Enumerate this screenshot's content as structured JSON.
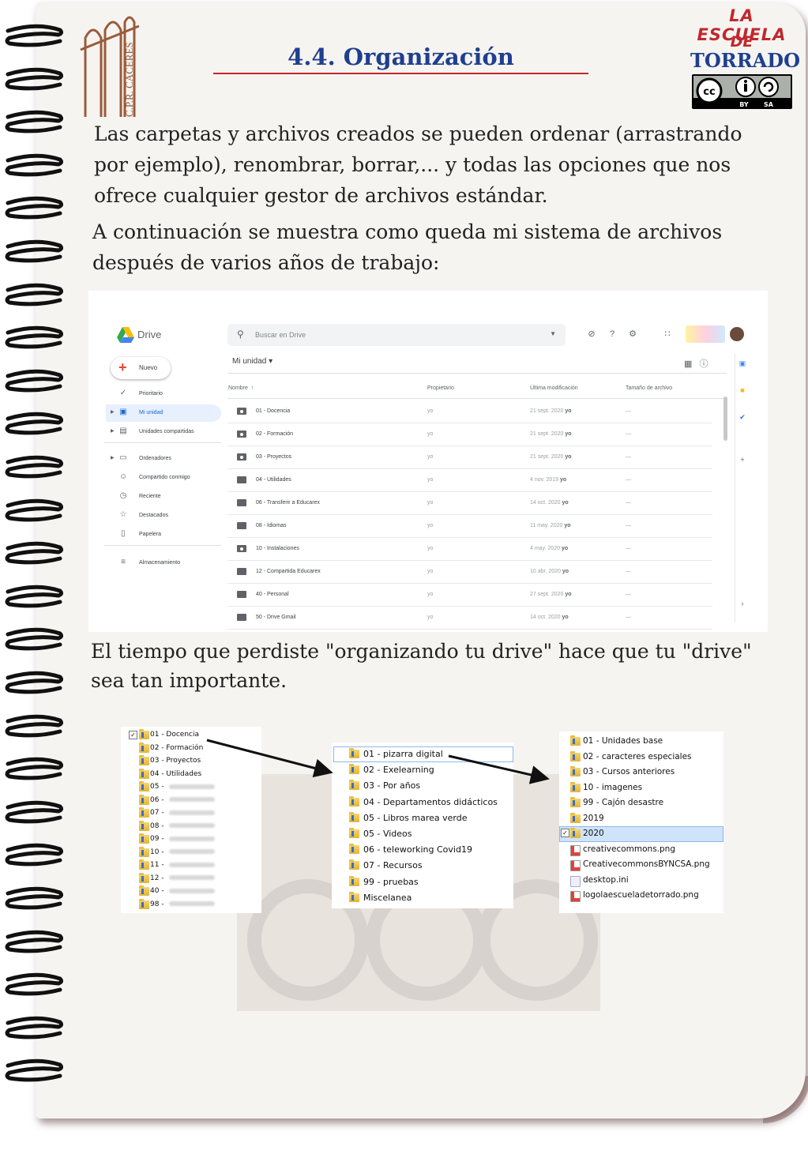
{
  "header": {
    "title": "4.4. Organización",
    "cpr_logo_text": "C.P.R. CÁCERES",
    "brand_line1": "LA ESCUELA",
    "brand_line2": "DE",
    "brand_line3": "TORRADO",
    "license_badge": {
      "cc": "cc",
      "by": "BY",
      "sa": "SA"
    }
  },
  "paragraphs": {
    "p1": "Las carpetas y archivos creados se pueden ordenar (arrastrando por ejemplo), renombrar, borrar,... y todas las opciones que nos ofrece cualquier gestor de archivos estándar.",
    "p2": "A continuación se muestra como queda mi sistema de archivos después de varios años de trabajo:",
    "p3": "El tiempo que perdiste \"organizando tu drive\" hace que tu \"drive\" sea tan importante."
  },
  "drive": {
    "app_name": "Drive",
    "search_placeholder": "Buscar en Drive",
    "new_button": "Nuevo",
    "breadcrumb": "Mi unidad",
    "nav": [
      {
        "label": "Prioritario",
        "icon": "check-circle-icon"
      },
      {
        "label": "Mi unidad",
        "icon": "my-drive-icon",
        "active": true
      },
      {
        "label": "Unidades compartidas",
        "icon": "shared-drives-icon"
      },
      {
        "label": "Ordenadores",
        "icon": "computer-icon"
      },
      {
        "label": "Compartido conmigo",
        "icon": "people-icon"
      },
      {
        "label": "Reciente",
        "icon": "clock-icon"
      },
      {
        "label": "Destacados",
        "icon": "star-icon"
      },
      {
        "label": "Papelera",
        "icon": "trash-icon"
      },
      {
        "label": "Almacenamiento",
        "icon": "storage-icon"
      }
    ],
    "columns": [
      "Nombre",
      "Propietario",
      "Última modificación",
      "Tamaño de archivo"
    ],
    "files": [
      {
        "name": "01 - Docencia",
        "owner": "yo",
        "modified": "21 sept. 2020",
        "by": "yo",
        "size": "—",
        "shared": true
      },
      {
        "name": "02 - Formación",
        "owner": "yo",
        "modified": "21 sept. 2020",
        "by": "yo",
        "size": "—",
        "shared": true
      },
      {
        "name": "03 - Proyectos",
        "owner": "yo",
        "modified": "21 sept. 2020",
        "by": "yo",
        "size": "—",
        "shared": true
      },
      {
        "name": "04 - Utilidades",
        "owner": "yo",
        "modified": "4 nov. 2019",
        "by": "yo",
        "size": "—",
        "shared": false
      },
      {
        "name": "06 - Transferir a Educarex",
        "owner": "yo",
        "modified": "14 oct. 2020",
        "by": "yo",
        "size": "—",
        "shared": false
      },
      {
        "name": "08 - Idiomas",
        "owner": "yo",
        "modified": "11 may. 2020",
        "by": "yo",
        "size": "—",
        "shared": false
      },
      {
        "name": "10 - Instalaciones",
        "owner": "yo",
        "modified": "4 may. 2020",
        "by": "yo",
        "size": "—",
        "shared": true
      },
      {
        "name": "12 - Compartida Educarex",
        "owner": "yo",
        "modified": "10 abr. 2020",
        "by": "yo",
        "size": "—",
        "shared": false
      },
      {
        "name": "40 - Personal",
        "owner": "yo",
        "modified": "27 sept. 2020",
        "by": "yo",
        "size": "—",
        "shared": false
      },
      {
        "name": "50 - Drive Gmail",
        "owner": "yo",
        "modified": "14 oct. 2020",
        "by": "yo",
        "size": "—",
        "shared": false
      }
    ]
  },
  "explorer1": {
    "items": [
      "01 - Docencia",
      "02 - Formación",
      "03 - Proyectos",
      "04 - Utilidades",
      "05 -",
      "06 -",
      "07 -",
      "08 -",
      "09 -",
      "10 -",
      "11 -",
      "12 -",
      "40 -",
      "98 -"
    ],
    "checked_index": 0
  },
  "explorer2": {
    "items": [
      "01 - pizarra digital",
      "02 - Exelearning",
      "03 - Por años",
      "04 - Departamentos didácticos",
      "05 - Libros marea verde",
      "05 - Videos",
      "06 - teleworking Covid19",
      "07 - Recursos",
      "99 - pruebas",
      "Miscelanea"
    ],
    "selected_index": 0
  },
  "explorer3": {
    "items": [
      {
        "name": "01 - Unidades base",
        "kind": "folder"
      },
      {
        "name": "02 - caracteres especiales",
        "kind": "folder"
      },
      {
        "name": "03 - Cursos anteriores",
        "kind": "folder"
      },
      {
        "name": "10 - imagenes",
        "kind": "folder"
      },
      {
        "name": "99 - Cajón desastre",
        "kind": "folder"
      },
      {
        "name": "2019",
        "kind": "folder"
      },
      {
        "name": "2020",
        "kind": "folder",
        "selected": true
      },
      {
        "name": "creativecommons.png",
        "kind": "image"
      },
      {
        "name": "CreativecommonsBYNCSA.png",
        "kind": "image"
      },
      {
        "name": "desktop.ini",
        "kind": "ini"
      },
      {
        "name": "logolaescueladetorrado.png",
        "kind": "image"
      }
    ]
  },
  "colors": {
    "title_blue": "#1f3f8f",
    "accent_red": "#c0282c",
    "selection": "#cfe3fa"
  }
}
